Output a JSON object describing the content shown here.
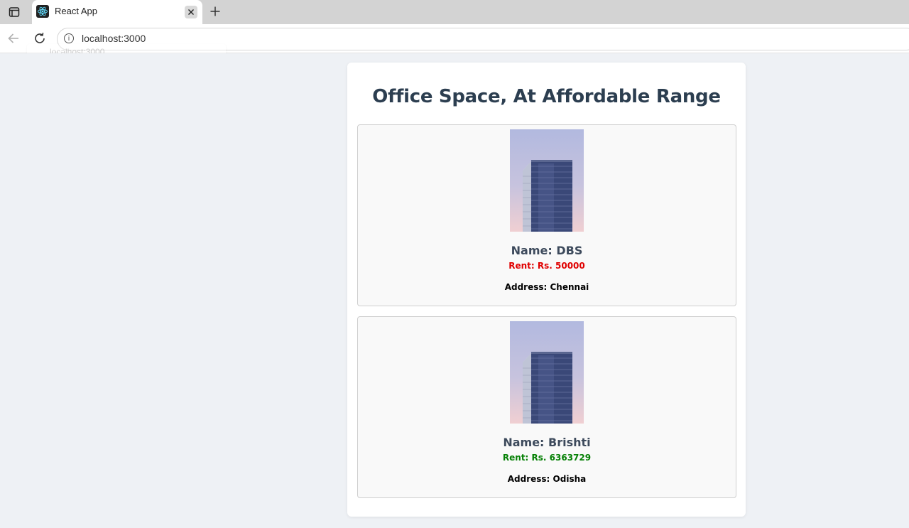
{
  "browser": {
    "tab_title": "React App",
    "url": "localhost:3000",
    "ghost_url": "localhost:3000",
    "favicon": "react-icon",
    "close_icon": "close-icon",
    "new_tab_icon": "plus-icon"
  },
  "page": {
    "heading": "Office Space, At Affordable Range",
    "offices": [
      {
        "name": "Name: DBS",
        "rent": "Rent: Rs. 50000",
        "rent_color": "#e00000",
        "address": "Address: Chennai",
        "image": "office-building-image"
      },
      {
        "name": "Name: Brishti",
        "rent": "Rent: Rs. 6363729",
        "rent_color": "#058005",
        "address": "Address: Odisha",
        "image": "office-building-image"
      }
    ]
  }
}
